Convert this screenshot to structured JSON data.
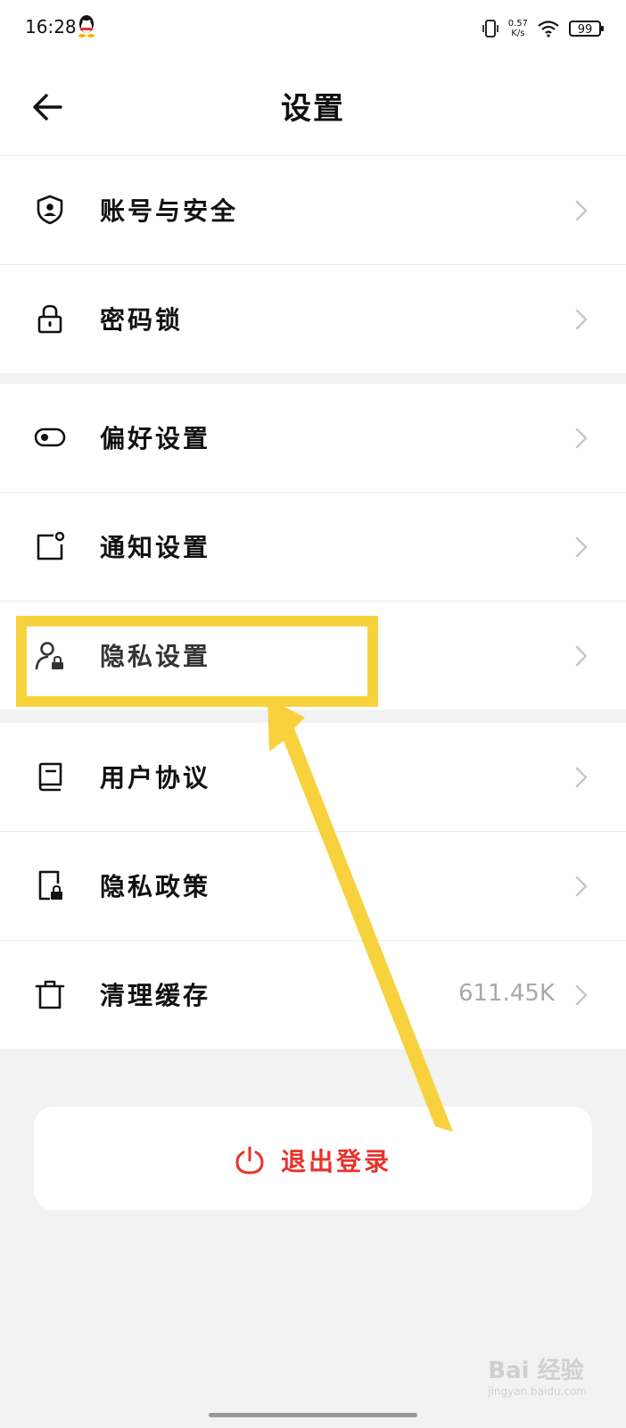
{
  "status_bar": {
    "time": "16:28",
    "speed_value": "0.57",
    "speed_unit": "K/s",
    "battery": "99"
  },
  "header": {
    "title": "设置"
  },
  "groups": [
    {
      "items": [
        {
          "label": "账号与安全",
          "icon": "shield-user-icon"
        },
        {
          "label": "密码锁",
          "icon": "lock-icon"
        }
      ]
    },
    {
      "items": [
        {
          "label": "偏好设置",
          "icon": "toggle-icon"
        },
        {
          "label": "通知设置",
          "icon": "notification-icon"
        },
        {
          "label": "隐私设置",
          "icon": "user-lock-icon"
        }
      ]
    },
    {
      "items": [
        {
          "label": "用户协议",
          "icon": "book-icon"
        },
        {
          "label": "隐私政策",
          "icon": "document-lock-icon"
        },
        {
          "label": "清理缓存",
          "icon": "trash-icon",
          "value": "611.45K"
        }
      ]
    }
  ],
  "logout": {
    "label": "退出登录",
    "icon": "power-icon",
    "color": "#e8322b"
  },
  "annotation": {
    "highlight_color": "#f7d23c",
    "target": "隐私设置"
  },
  "watermark": {
    "text": "Bai 经验",
    "sub": "jingyan.baidu.com"
  }
}
